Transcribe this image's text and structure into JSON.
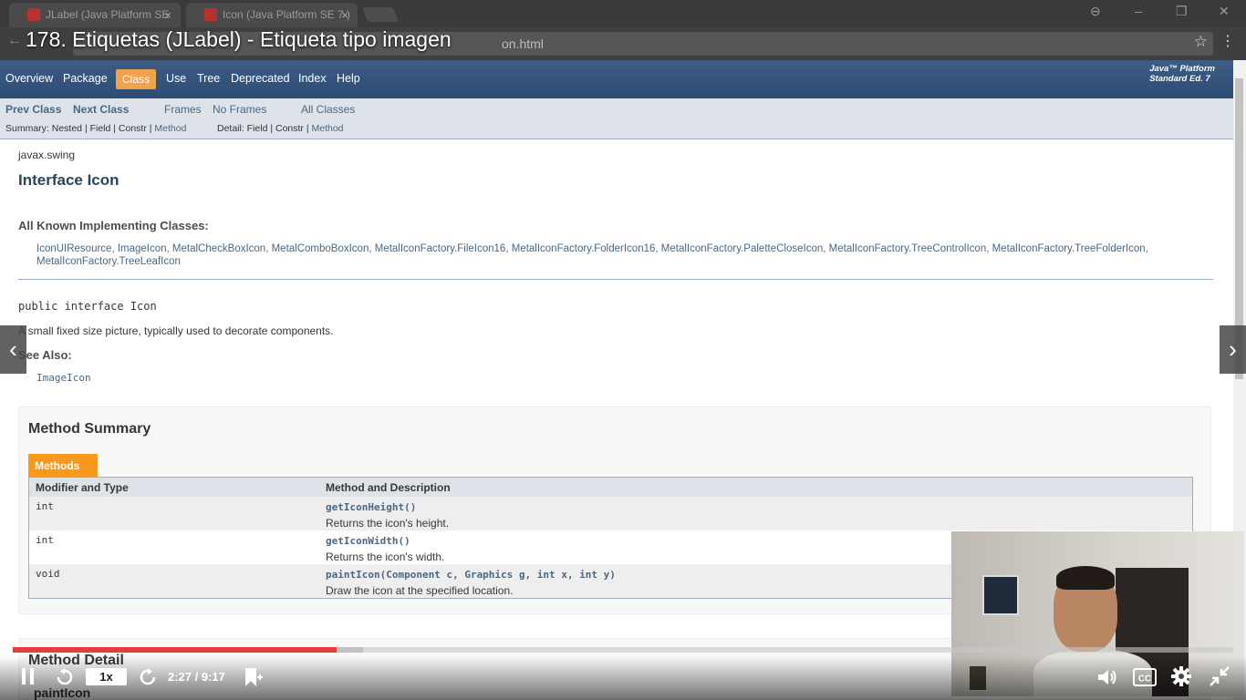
{
  "browser": {
    "tabs": [
      {
        "title": "JLabel (Java Platform SE",
        "close": "×"
      },
      {
        "title": "Icon (Java Platform SE 7 )",
        "close": "×"
      }
    ],
    "url_tail": "on.html",
    "star": "☆",
    "menu": "⋮",
    "window_controls": [
      "⊖",
      "–",
      "❐",
      "✕"
    ]
  },
  "video_title": "178. Etiquetas (JLabel) - Etiqueta tipo imagen",
  "javadoc": {
    "top_nav": [
      "Overview",
      "Package",
      "Class",
      "Use",
      "Tree",
      "Deprecated",
      "Index",
      "Help"
    ],
    "active_nav": "Class",
    "platform_line1": "Java™ Platform",
    "platform_line2": "Standard Ed. 7",
    "sub_nav": {
      "prev": "Prev Class",
      "next": "Next Class",
      "frames": "Frames",
      "no_frames": "No Frames",
      "all_classes": "All Classes",
      "summary_label": "Summary: Nested | Field | Constr | ",
      "summary_method": "Method",
      "detail_label": "Detail: Field | Constr | ",
      "detail_method": "Method"
    },
    "package": "javax.swing",
    "title": "Interface Icon",
    "known_heading": "All Known Implementing Classes:",
    "known_classes": "IconUIResource, ImageIcon, MetalCheckBoxIcon, MetalComboBoxIcon, MetalIconFactory.FileIcon16, MetalIconFactory.FolderIcon16, MetalIconFactory.PaletteCloseIcon, MetalIconFactory.TreeControlIcon, MetalIconFactory.TreeFolderIcon, MetalIconFactory.TreeLeafIcon",
    "declaration": "public interface Icon",
    "description": "A small fixed size picture, typically used to decorate components.",
    "see_also": "See Also:",
    "see_also_link": "ImageIcon",
    "method_summary": "Method Summary",
    "methods_tab": "Methods",
    "col1": "Modifier and Type",
    "col2": "Method and Description",
    "methods": [
      {
        "type": "int",
        "sig": "getIconHeight()",
        "desc": "Returns the icon's height."
      },
      {
        "type": "int",
        "sig": "getIconWidth()",
        "desc": "Returns the icon's width."
      },
      {
        "type": "void",
        "sig": "paintIcon(Component c, Graphics g, int x, int y)",
        "desc": "Draw the icon at the specified location."
      }
    ],
    "method_detail": "Method Detail",
    "detail_first": "paintIcon"
  },
  "player": {
    "progress": 0.265,
    "rate": "1x",
    "time": "2:27 / 9:17",
    "prev": "‹",
    "next": "›"
  }
}
